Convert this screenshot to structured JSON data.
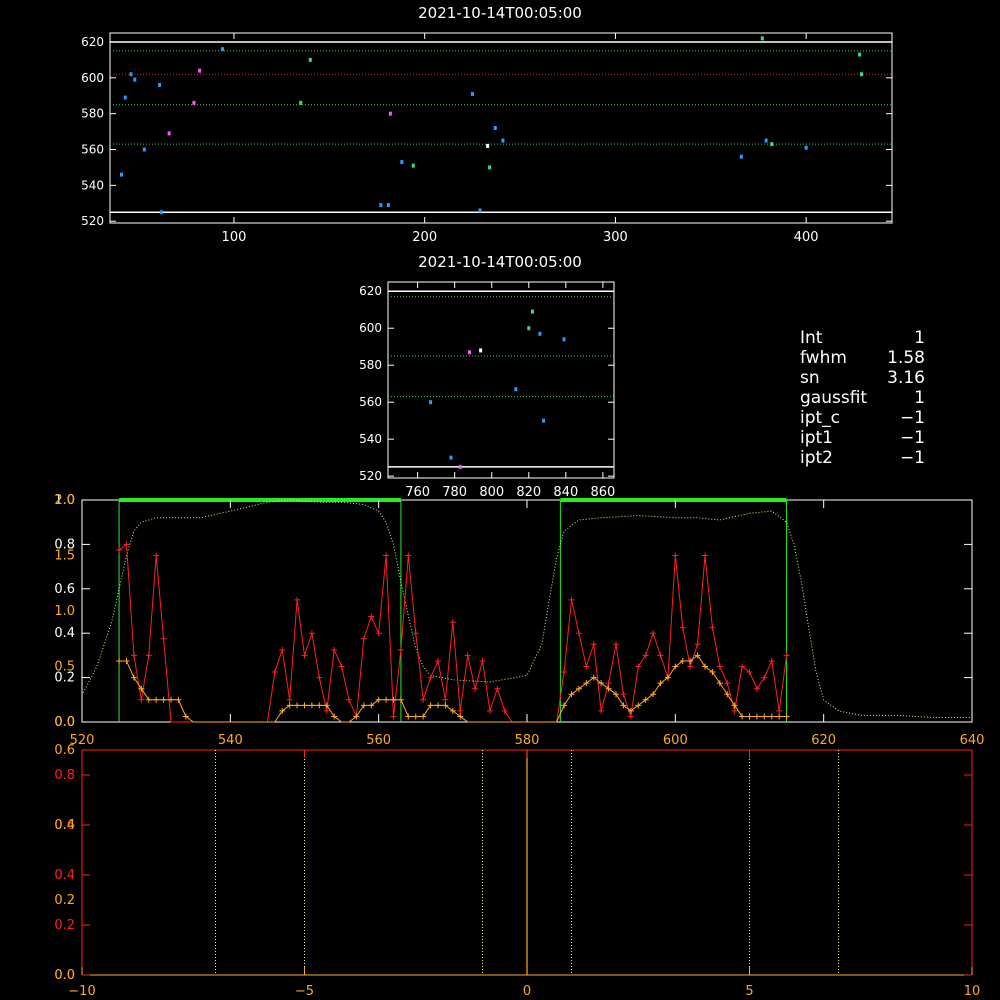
{
  "chart_data": [
    {
      "id": "top-scatter",
      "type": "scatter",
      "title": "2021-10-14T00:05:00",
      "xlim": [
        35,
        445
      ],
      "ylim": [
        519,
        625
      ],
      "xticks": [
        100,
        200,
        300,
        400
      ],
      "yticks": [
        520,
        540,
        560,
        580,
        600,
        620
      ],
      "hlines": [
        {
          "y": 620,
          "style": "solid",
          "color": "#ffffff"
        },
        {
          "y": 615,
          "style": "dotted",
          "color": "#33cc55"
        },
        {
          "y": 602,
          "style": "dotted",
          "color": "#cc3333"
        },
        {
          "y": 585,
          "style": "dotted",
          "color": "#33cc55"
        },
        {
          "y": 563,
          "style": "dotted",
          "color": "#33cc55"
        },
        {
          "y": 525,
          "style": "solid",
          "color": "#ffffff"
        }
      ],
      "points": [
        {
          "x": 41,
          "y": 546,
          "c": "#2b9cff"
        },
        {
          "x": 43,
          "y": 589,
          "c": "#2b9cff"
        },
        {
          "x": 46,
          "y": 602,
          "c": "#2b9cff"
        },
        {
          "x": 48,
          "y": 599,
          "c": "#2b9cff"
        },
        {
          "x": 53,
          "y": 560,
          "c": "#2b9cff"
        },
        {
          "x": 61,
          "y": 596,
          "c": "#2b9cff"
        },
        {
          "x": 62,
          "y": 525,
          "c": "#2b9cff"
        },
        {
          "x": 66,
          "y": 569,
          "c": "#ff55ff"
        },
        {
          "x": 79,
          "y": 586,
          "c": "#ff55ff"
        },
        {
          "x": 82,
          "y": 604,
          "c": "#ff55ff"
        },
        {
          "x": 94,
          "y": 616,
          "c": "#2b9cff"
        },
        {
          "x": 135,
          "y": 586,
          "c": "#33dd88"
        },
        {
          "x": 140,
          "y": 610,
          "c": "#33dd88"
        },
        {
          "x": 177,
          "y": 529,
          "c": "#2b9cff"
        },
        {
          "x": 181,
          "y": 529,
          "c": "#2b9cff"
        },
        {
          "x": 182,
          "y": 580,
          "c": "#ff55ff"
        },
        {
          "x": 188,
          "y": 553,
          "c": "#2b9cff"
        },
        {
          "x": 194,
          "y": 551,
          "c": "#33dd88"
        },
        {
          "x": 225,
          "y": 591,
          "c": "#2b9cff"
        },
        {
          "x": 229,
          "y": 526,
          "c": "#2b9cff"
        },
        {
          "x": 233,
          "y": 562,
          "c": "#ffffff"
        },
        {
          "x": 234,
          "y": 550,
          "c": "#33dd88"
        },
        {
          "x": 237,
          "y": 572,
          "c": "#2b9cff"
        },
        {
          "x": 241,
          "y": 565,
          "c": "#2b9cff"
        },
        {
          "x": 366,
          "y": 556,
          "c": "#2b9cff"
        },
        {
          "x": 377,
          "y": 622,
          "c": "#33dd88"
        },
        {
          "x": 379,
          "y": 565,
          "c": "#2b9cff"
        },
        {
          "x": 382,
          "y": 563,
          "c": "#33dd88"
        },
        {
          "x": 400,
          "y": 561,
          "c": "#2b9cff"
        },
        {
          "x": 428,
          "y": 613,
          "c": "#33dd88"
        },
        {
          "x": 429,
          "y": 602,
          "c": "#33dd88"
        }
      ]
    },
    {
      "id": "mid-scatter",
      "type": "scatter",
      "title": "2021-10-14T00:05:00",
      "xlim": [
        744,
        866
      ],
      "ylim": [
        519,
        625
      ],
      "xticks": [
        760,
        780,
        800,
        820,
        840,
        860
      ],
      "yticks": [
        520,
        540,
        560,
        580,
        600,
        620
      ],
      "hlines": [
        {
          "y": 620,
          "style": "solid",
          "color": "#ffffff"
        },
        {
          "y": 617,
          "style": "dotted",
          "color": "#33cc55"
        },
        {
          "y": 585,
          "style": "dotted",
          "color": "#33cc55"
        },
        {
          "y": 563,
          "style": "dotted",
          "color": "#33cc55"
        },
        {
          "y": 525,
          "style": "solid",
          "color": "#ffffff"
        }
      ],
      "points": [
        {
          "x": 767,
          "y": 560,
          "c": "#2b9cff"
        },
        {
          "x": 778,
          "y": 530,
          "c": "#2b9cff"
        },
        {
          "x": 783,
          "y": 525,
          "c": "#ff55ff"
        },
        {
          "x": 788,
          "y": 587,
          "c": "#ff55ff"
        },
        {
          "x": 794,
          "y": 588,
          "c": "#ffffff"
        },
        {
          "x": 813,
          "y": 567,
          "c": "#2b9cff"
        },
        {
          "x": 820,
          "y": 600,
          "c": "#33dd88"
        },
        {
          "x": 822,
          "y": 609,
          "c": "#33dd88"
        },
        {
          "x": 826,
          "y": 597,
          "c": "#2b9cff"
        },
        {
          "x": 828,
          "y": 550,
          "c": "#2b9cff"
        },
        {
          "x": 839,
          "y": 594,
          "c": "#2b9cff"
        }
      ]
    },
    {
      "id": "spectrum",
      "type": "line",
      "xlim": [
        520,
        640
      ],
      "xticks": [
        520,
        540,
        560,
        580,
        600,
        620,
        640
      ],
      "y_left_white": {
        "lim": [
          0,
          1.0
        ],
        "ticks": [
          0.0,
          0.2,
          0.4,
          0.6,
          0.8,
          1.0
        ]
      },
      "y_left_orange": {
        "lim": [
          0,
          2.0
        ],
        "ticks": [
          0.0,
          0.5,
          1.0,
          1.5,
          2.0
        ]
      },
      "bands": [
        [
          525,
          563
        ],
        [
          584.5,
          615
        ]
      ],
      "band_top": 1.0,
      "transmission": {
        "x": [
          520,
          522,
          524,
          525,
          526,
          527,
          528,
          529,
          530,
          533,
          536,
          540,
          545,
          548,
          552,
          555,
          558,
          560,
          561,
          562,
          563,
          564,
          565,
          566,
          567,
          570,
          575,
          580,
          582,
          583,
          584,
          585,
          587,
          590,
          595,
          600,
          603,
          606,
          610,
          613,
          615,
          616,
          617,
          618,
          619,
          620,
          622,
          625,
          630,
          635,
          640
        ],
        "y": [
          0.12,
          0.25,
          0.45,
          0.6,
          0.75,
          0.86,
          0.9,
          0.91,
          0.92,
          0.92,
          0.92,
          0.95,
          0.99,
          1.0,
          0.99,
          0.99,
          0.98,
          0.95,
          0.9,
          0.8,
          0.63,
          0.48,
          0.33,
          0.25,
          0.21,
          0.19,
          0.18,
          0.21,
          0.35,
          0.55,
          0.74,
          0.86,
          0.91,
          0.92,
          0.93,
          0.92,
          0.92,
          0.91,
          0.94,
          0.95,
          0.9,
          0.8,
          0.63,
          0.42,
          0.22,
          0.1,
          0.05,
          0.03,
          0.03,
          0.02,
          0.02
        ]
      },
      "red_series": {
        "x": [
          525,
          526,
          527,
          528,
          529,
          530,
          531,
          532,
          533,
          534,
          535,
          536,
          537,
          538,
          539,
          540,
          541,
          542,
          543,
          544,
          545,
          546,
          547,
          548,
          549,
          550,
          551,
          552,
          553,
          554,
          555,
          556,
          557,
          558,
          559,
          560,
          561,
          562,
          563,
          564,
          565,
          566,
          567,
          568,
          569,
          570,
          571,
          572,
          573,
          574,
          575,
          576,
          577,
          578,
          579,
          580,
          581,
          582,
          583,
          584,
          585,
          586,
          587,
          588,
          589,
          590,
          591,
          592,
          593,
          594,
          595,
          596,
          597,
          598,
          599,
          600,
          601,
          602,
          603,
          604,
          605,
          606,
          607,
          608,
          609,
          610,
          611,
          612,
          613,
          614,
          615
        ],
        "y": [
          1.55,
          1.6,
          0.6,
          0.2,
          0.6,
          1.5,
          0.75,
          0,
          0,
          0,
          0,
          0,
          0,
          0,
          0,
          0,
          0,
          0,
          0,
          0,
          0,
          0.45,
          0.65,
          0.2,
          1.1,
          0.6,
          0.8,
          0.4,
          0.1,
          0.65,
          0.5,
          0.2,
          0.05,
          0.75,
          0.95,
          0.8,
          1.5,
          0.05,
          0.65,
          1.5,
          0.8,
          0.2,
          0.4,
          0.55,
          0.2,
          0.9,
          0.1,
          0.6,
          0.3,
          0.55,
          0.1,
          0.3,
          0.1,
          0,
          0,
          0,
          0,
          0,
          0,
          0,
          0.45,
          1.1,
          0.8,
          0.5,
          0.7,
          0.1,
          0.35,
          0.7,
          0.25,
          0.05,
          0.5,
          0.6,
          0.8,
          0.6,
          0.4,
          1.5,
          0.85,
          0.5,
          0.7,
          1.5,
          0.85,
          0.5,
          0.35,
          0.1,
          0.5,
          0.45,
          0.3,
          0.4,
          0.55,
          0.1,
          0.6
        ]
      },
      "orange_series": {
        "x": [
          525,
          526,
          527,
          528,
          529,
          530,
          531,
          532,
          533,
          534,
          535,
          536,
          537,
          538,
          539,
          540,
          541,
          542,
          543,
          544,
          545,
          546,
          547,
          548,
          549,
          550,
          551,
          552,
          553,
          554,
          555,
          556,
          557,
          558,
          559,
          560,
          561,
          562,
          563,
          564,
          565,
          566,
          567,
          568,
          569,
          570,
          571,
          572,
          573,
          574,
          575,
          576,
          577,
          578,
          579,
          580,
          581,
          582,
          583,
          584,
          585,
          586,
          587,
          588,
          589,
          590,
          591,
          592,
          593,
          594,
          595,
          596,
          597,
          598,
          599,
          600,
          601,
          602,
          603,
          604,
          605,
          606,
          607,
          608,
          609,
          610,
          611,
          612,
          613,
          614,
          615
        ],
        "y": [
          0.55,
          0.55,
          0.4,
          0.3,
          0.2,
          0.2,
          0.2,
          0.2,
          0.2,
          0.05,
          0,
          0,
          0,
          0,
          0,
          0,
          0,
          0,
          0,
          0,
          0,
          0,
          0.1,
          0.15,
          0.15,
          0.15,
          0.15,
          0.15,
          0.15,
          0.05,
          0,
          0,
          0.05,
          0.15,
          0.15,
          0.2,
          0.2,
          0.2,
          0.2,
          0.05,
          0.05,
          0.05,
          0.15,
          0.15,
          0.15,
          0.1,
          0.05,
          0,
          0,
          0,
          0,
          0,
          0,
          0,
          0,
          0,
          0,
          0,
          0,
          0,
          0.15,
          0.25,
          0.3,
          0.35,
          0.4,
          0.35,
          0.3,
          0.25,
          0.15,
          0.1,
          0.15,
          0.2,
          0.25,
          0.35,
          0.4,
          0.5,
          0.55,
          0.55,
          0.6,
          0.5,
          0.45,
          0.35,
          0.25,
          0.15,
          0.05,
          0.05,
          0.05,
          0.05,
          0.05,
          0.05,
          0.05
        ]
      }
    },
    {
      "id": "lower",
      "type": "line",
      "xlim": [
        -10,
        10
      ],
      "xticks": [
        -10,
        -5,
        0,
        5,
        10
      ],
      "yticks_red": [
        0.0,
        0.2,
        0.4,
        0.6,
        0.8
      ],
      "yticks_orange": [
        0.0,
        0.2,
        0.4,
        0.6
      ],
      "vlines_dotted": [
        -7,
        -5,
        -1,
        1,
        5,
        7
      ],
      "vline_solid": 0
    }
  ],
  "info_panel": {
    "lines": [
      {
        "label": "Int",
        "value": "1"
      },
      {
        "label": "fwhm",
        "value": "1.58"
      },
      {
        "label": "sn",
        "value": "3.16"
      },
      {
        "label": "gaussfit",
        "value": "1"
      },
      {
        "label": "ipt_c",
        "value": "−1"
      },
      {
        "label": "ipt1",
        "value": "−1"
      },
      {
        "label": "ipt2",
        "value": "−1"
      }
    ]
  },
  "colors": {
    "white": "#ffffff",
    "red": "#ff2020",
    "orange": "#ffaa22",
    "green": "#22ee22",
    "dotgreen": "#33cc55"
  }
}
